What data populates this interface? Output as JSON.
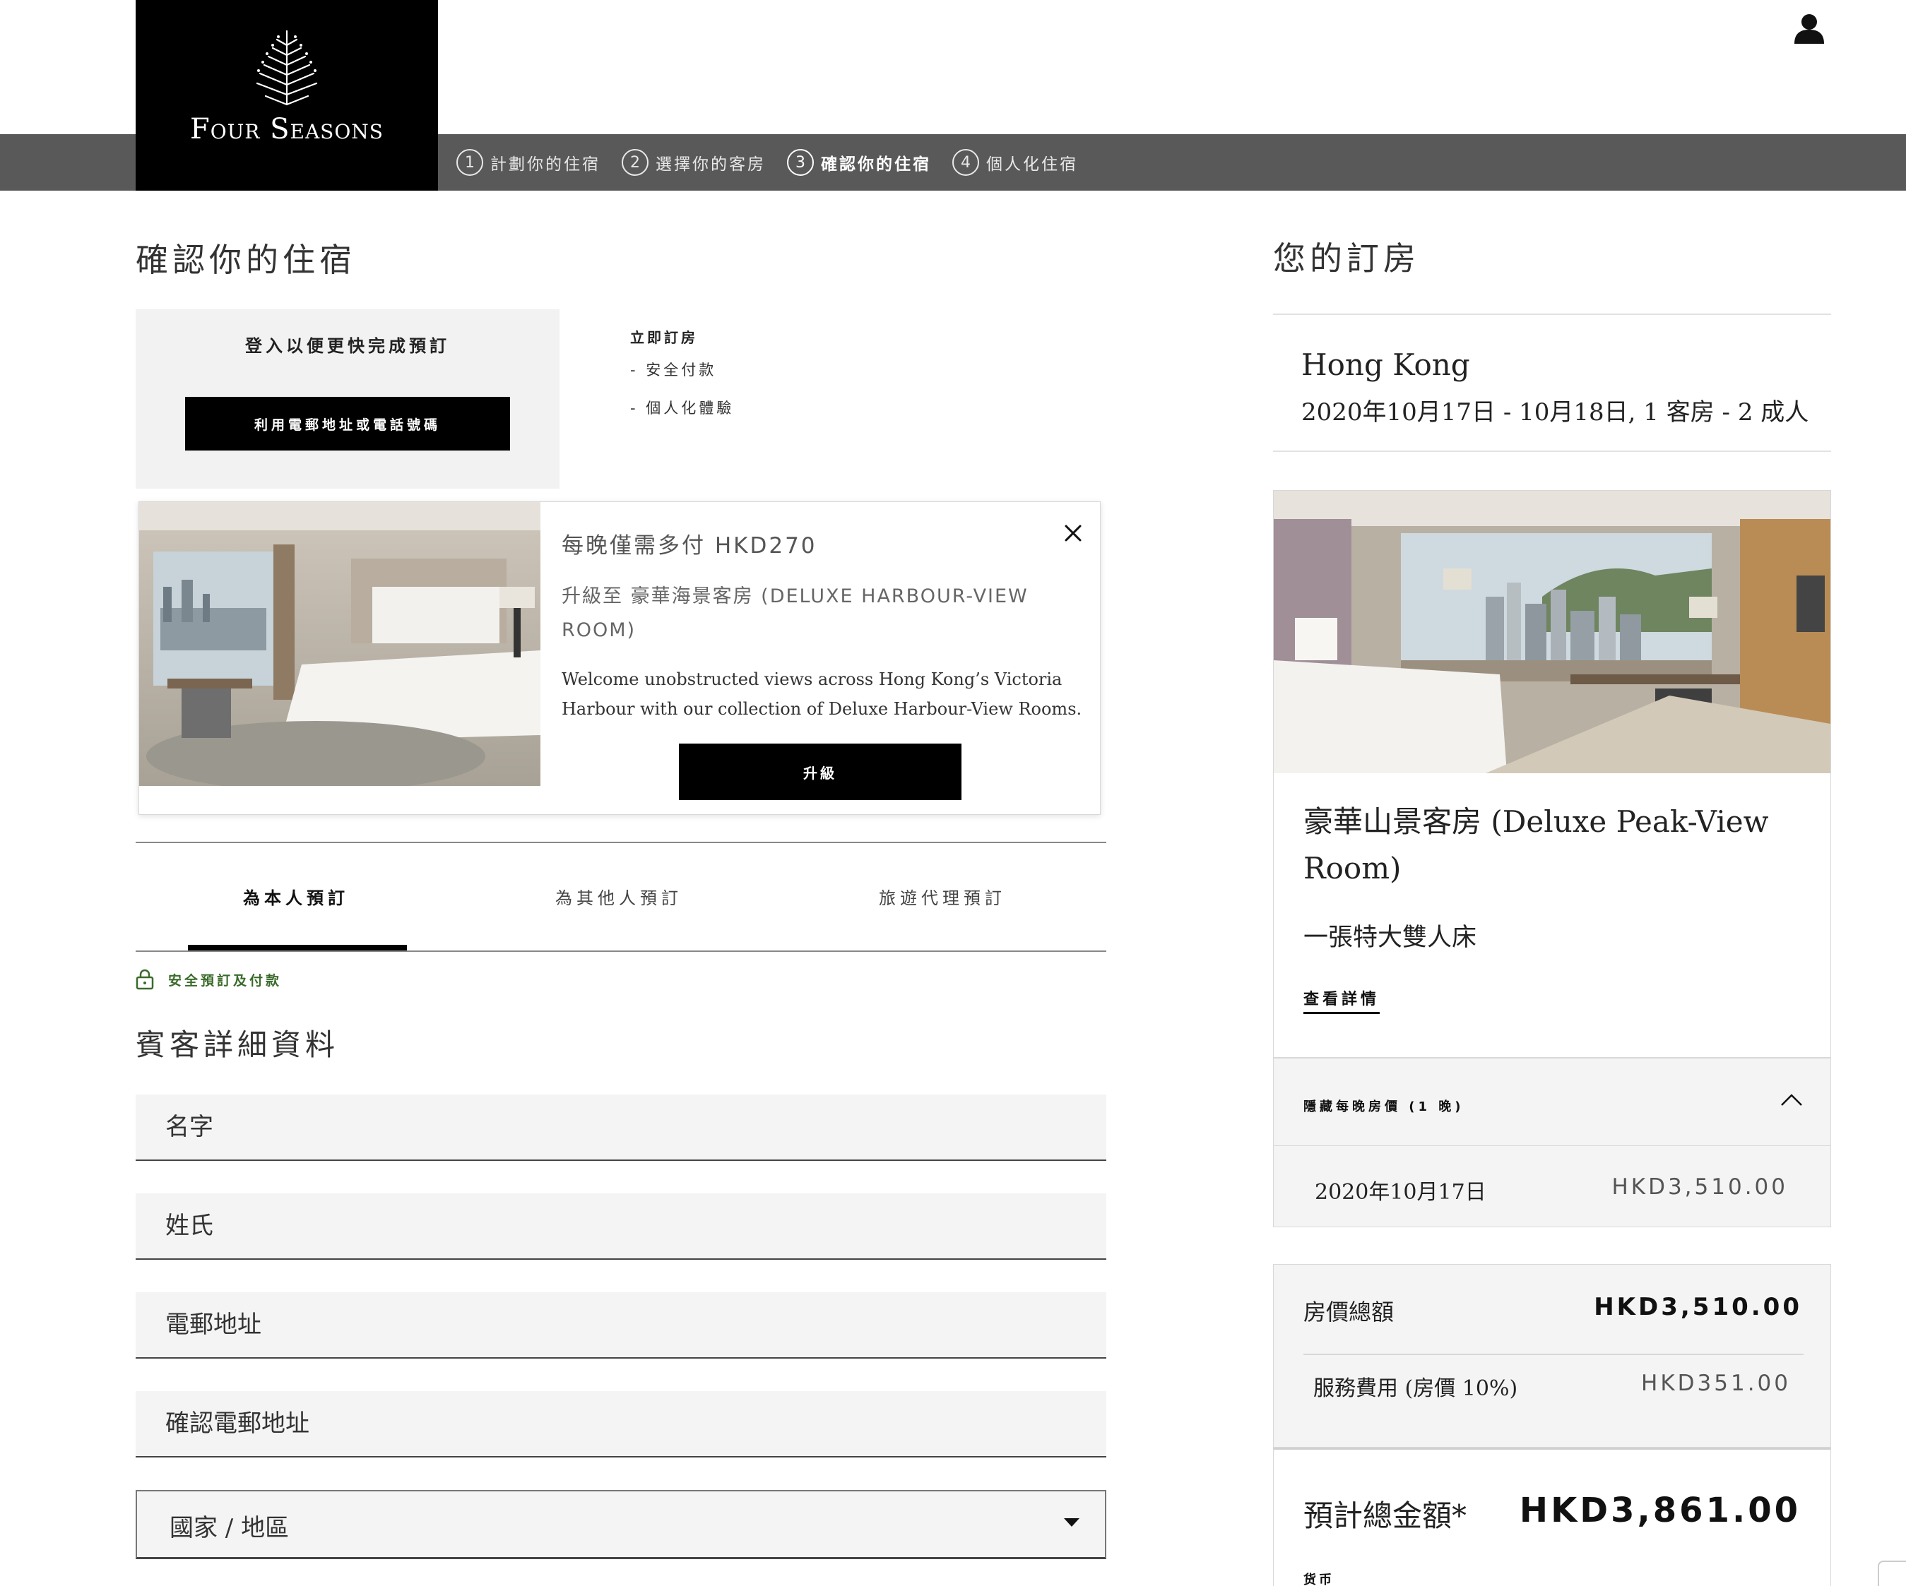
{
  "brand": {
    "name": "Four Seasons"
  },
  "steps": [
    {
      "num": "1",
      "label": "計劃你的住宿"
    },
    {
      "num": "2",
      "label": "選擇你的客房"
    },
    {
      "num": "3",
      "label": "確認你的住宿"
    },
    {
      "num": "4",
      "label": "個人化住宿"
    }
  ],
  "active_step": 3,
  "page_title": "確認你的住宿",
  "login": {
    "title": "登入以便更快完成預訂",
    "button": "利用電郵地址或電話號碼"
  },
  "book_now": {
    "title": "立即訂房",
    "items": [
      "- 安全付款",
      "- 個人化體驗"
    ]
  },
  "upgrade": {
    "price": "每晚僅需多付 HKD270",
    "room": "升級至 豪華海景客房 (DELUXE HARBOUR-VIEW ROOM)",
    "description": "Welcome unobstructed views across Hong Kong’s Victoria Harbour with our collection of Deluxe Harbour-View Rooms.",
    "button": "升級"
  },
  "tabs": [
    "為本人預訂",
    "為其他人預訂",
    "旅遊代理預訂"
  ],
  "secure_label": "安全預訂及付款",
  "guest_title": "賓客詳細資料",
  "form": {
    "first_name": "名字",
    "last_name": "姓氏",
    "email": "電郵地址",
    "confirm_email": "確認電郵地址",
    "country": "國家 / 地區"
  },
  "booking": {
    "title": "您的訂房",
    "city": "Hong Kong",
    "dates": "2020年10月17日 - 10月18日, 1 客房 - 2 成人",
    "room_name": "豪華山景客房 (Deluxe Peak-View Room)",
    "bed": "一張特大雙人床",
    "details_link": "查看詳情",
    "nightly_toggle": "隱藏每晚房價 (1 晚)",
    "nightly": [
      {
        "date": "2020年10月17日",
        "amount": "HKD3,510.00"
      }
    ],
    "room_total_label": "房價總額",
    "room_total": "HKD3,510.00",
    "service_label": "服務費用 (房價 10%)",
    "service_amount": "HKD351.00",
    "grand_label": "預計總金額*",
    "grand_total": "HKD3,861.00",
    "currency_label": "货币"
  },
  "colors": {
    "step_bar": "#595959",
    "secure_green": "#3a6b2a",
    "accent": "#000000"
  }
}
